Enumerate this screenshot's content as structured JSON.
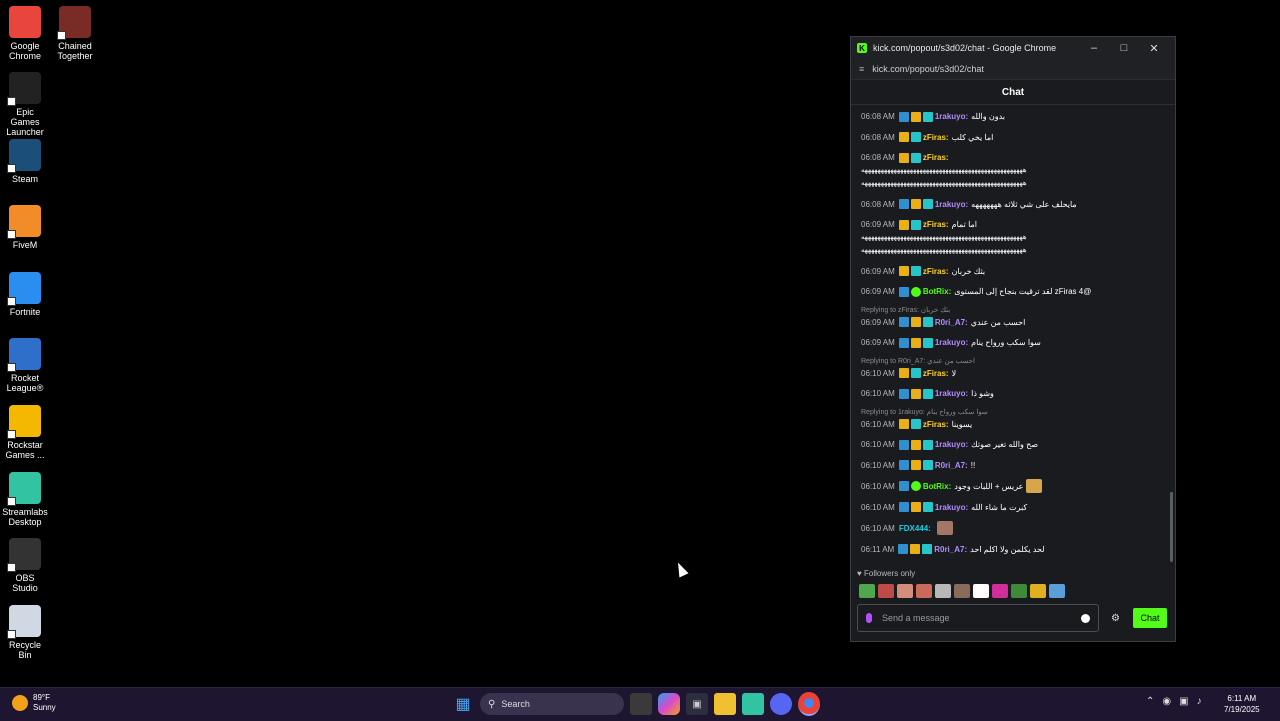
{
  "desktop_icons": [
    {
      "label": "Google Chrome",
      "color": "#e8453c"
    },
    {
      "label": "Chained Together",
      "color": "#7a2b25"
    },
    {
      "label": "Epic Games Launcher",
      "color": "#222222"
    },
    {
      "label": "Steam",
      "color": "#1b4f7a"
    },
    {
      "label": "FiveM",
      "color": "#f28c28"
    },
    {
      "label": "Fortnite",
      "color": "#2a8df0"
    },
    {
      "label": "Rocket League®",
      "color": "#2d6fc9"
    },
    {
      "label": "Rockstar Games ...",
      "color": "#f5b800"
    },
    {
      "label": "Streamlabs Desktop",
      "color": "#31c3a2"
    },
    {
      "label": "OBS Studio",
      "color": "#333333"
    },
    {
      "label": "Recycle Bin",
      "color": "#cfd8e3"
    }
  ],
  "window": {
    "title": "kick.com/popout/s3d02/chat - Google Chrome",
    "url": "kick.com/popout/s3d02/chat",
    "chat_header": "Chat"
  },
  "messages": [
    {
      "time": "06:08 AM",
      "badges": [
        "mod",
        "crown",
        "sub"
      ],
      "user": "1rakuyo",
      "ucolor": "purple",
      "text": "بدون والله"
    },
    {
      "time": "06:08 AM",
      "badges": [
        "crown",
        "sub"
      ],
      "user": "zFiras",
      "ucolor": "yellow",
      "text": "اما يخي كلب"
    },
    {
      "time": "06:08 AM",
      "badges": [
        "crown",
        "sub"
      ],
      "user": "zFiras",
      "ucolor": "yellow",
      "text": "",
      "long": [
        "ههههههههههههههههههههههههههههههههههههههههههههههههههه",
        "ههههههههههههههههههههههههههههههههههههههههههههههههههه"
      ]
    },
    {
      "time": "06:08 AM",
      "badges": [
        "mod",
        "crown",
        "sub"
      ],
      "user": "1rakuyo",
      "ucolor": "purple",
      "text": "مايحلف على شي ثلاثه هههههههه"
    },
    {
      "time": "06:09 AM",
      "badges": [
        "crown",
        "sub"
      ],
      "user": "zFiras",
      "ucolor": "yellow",
      "text": "اما تمام",
      "long": [
        "ههههههههههههههههههههههههههههههههههههههههههههههههههه",
        "ههههههههههههههههههههههههههههههههههههههههههههههههههه"
      ]
    },
    {
      "time": "06:09 AM",
      "badges": [
        "crown",
        "sub"
      ],
      "user": "zFiras",
      "ucolor": "yellow",
      "text": "بثك خربان"
    },
    {
      "time": "06:09 AM",
      "badges": [
        "mod",
        "bot"
      ],
      "user": "BotRix",
      "ucolor": "green",
      "text": "@zFiras 4 لقد ترقيت بنجاح إلى المستوى"
    },
    {
      "reply": "Replying to zFiras: بثك خربان",
      "time": "06:09 AM",
      "badges": [
        "mod",
        "crown",
        "sub"
      ],
      "user": "R0ri_A7",
      "ucolor": "purple",
      "text": "احسب من عندي"
    },
    {
      "time": "06:09 AM",
      "badges": [
        "mod",
        "crown",
        "sub"
      ],
      "user": "1rakuyo",
      "ucolor": "purple",
      "text": "سوا سكب ورواح ينام"
    },
    {
      "reply": "Replying to R0ri_A7: احسب من عندي",
      "time": "06:10 AM",
      "badges": [
        "crown",
        "sub"
      ],
      "user": "zFiras",
      "ucolor": "yellow",
      "text": "لا"
    },
    {
      "time": "06:10 AM",
      "badges": [
        "mod",
        "crown",
        "sub"
      ],
      "user": "1rakuyo",
      "ucolor": "purple",
      "text": "وشو ذا"
    },
    {
      "reply": "Replying to 1rakuyo: سوا سكب ورواح ينام",
      "time": "06:10 AM",
      "badges": [
        "crown",
        "sub"
      ],
      "user": "zFiras",
      "ucolor": "yellow",
      "text": "يسوينا"
    },
    {
      "time": "06:10 AM",
      "badges": [
        "mod",
        "crown",
        "sub"
      ],
      "user": "1rakuyo",
      "ucolor": "purple",
      "text": "صح والله تغير صوتك"
    },
    {
      "time": "06:10 AM",
      "badges": [
        "mod",
        "crown",
        "sub"
      ],
      "user": "R0ri_A7",
      "ucolor": "purple",
      "text": "!!"
    },
    {
      "time": "06:10 AM",
      "badges": [
        "mod",
        "bot"
      ],
      "user": "BotRix",
      "ucolor": "green",
      "text": "عريس + اللبات وجود",
      "emote": "#d9a54a"
    },
    {
      "time": "06:10 AM",
      "badges": [
        "mod",
        "crown",
        "sub"
      ],
      "user": "1rakuyo",
      "ucolor": "purple",
      "text": "كبرت ما شاء الله"
    },
    {
      "time": "06:10 AM",
      "badges": [],
      "user": "FDX444",
      "ucolor": "cyan",
      "text": "",
      "emote": "#a27766"
    },
    {
      "time": "06:11 AM",
      "badges": [
        "mod",
        "crown",
        "sub"
      ],
      "user": "R0ri_A7",
      "ucolor": "purple",
      "text": "لحد يكلمن ولا اكلم احد"
    }
  ],
  "followers_only": "Followers only",
  "emote_colors": [
    "#4fa84b",
    "#c04a4a",
    "#d48c7c",
    "#c96a5a",
    "#b8b8b8",
    "#8a6a5a",
    "#ffffff",
    "#d12e9c",
    "#3f8a3a",
    "#e0b020",
    "#5aa0d8"
  ],
  "input": {
    "placeholder": "Send a message",
    "button": "Chat"
  },
  "taskbar": {
    "weather_temp": "89°F",
    "weather_desc": "Sunny",
    "search_label": "Search",
    "time": "6:11 AM",
    "date": "7/19/2025"
  }
}
